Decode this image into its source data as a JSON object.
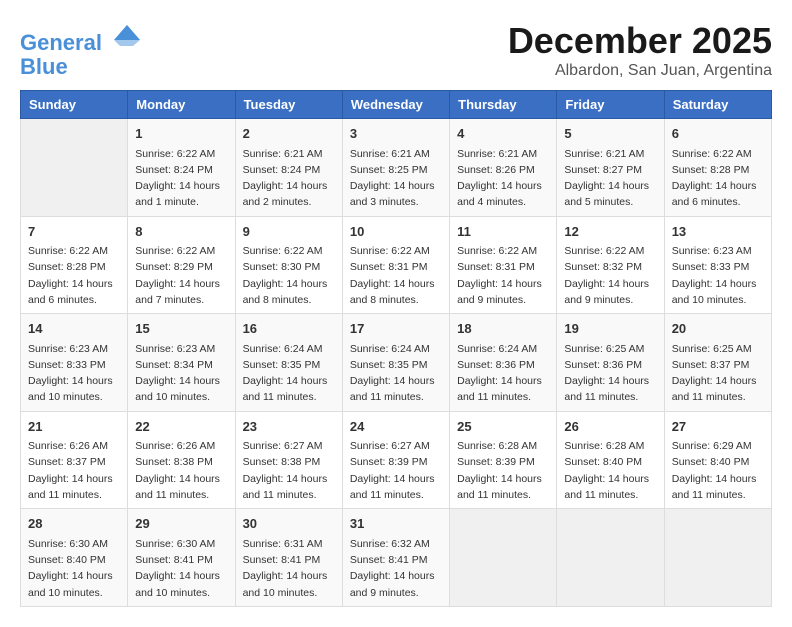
{
  "header": {
    "logo_line1": "General",
    "logo_line2": "Blue",
    "month": "December 2025",
    "location": "Albardon, San Juan, Argentina"
  },
  "days_of_week": [
    "Sunday",
    "Monday",
    "Tuesday",
    "Wednesday",
    "Thursday",
    "Friday",
    "Saturday"
  ],
  "weeks": [
    [
      {
        "day": "",
        "content": ""
      },
      {
        "day": "1",
        "content": "Sunrise: 6:22 AM\nSunset: 8:24 PM\nDaylight: 14 hours\nand 1 minute."
      },
      {
        "day": "2",
        "content": "Sunrise: 6:21 AM\nSunset: 8:24 PM\nDaylight: 14 hours\nand 2 minutes."
      },
      {
        "day": "3",
        "content": "Sunrise: 6:21 AM\nSunset: 8:25 PM\nDaylight: 14 hours\nand 3 minutes."
      },
      {
        "day": "4",
        "content": "Sunrise: 6:21 AM\nSunset: 8:26 PM\nDaylight: 14 hours\nand 4 minutes."
      },
      {
        "day": "5",
        "content": "Sunrise: 6:21 AM\nSunset: 8:27 PM\nDaylight: 14 hours\nand 5 minutes."
      },
      {
        "day": "6",
        "content": "Sunrise: 6:22 AM\nSunset: 8:28 PM\nDaylight: 14 hours\nand 6 minutes."
      }
    ],
    [
      {
        "day": "7",
        "content": "Sunrise: 6:22 AM\nSunset: 8:28 PM\nDaylight: 14 hours\nand 6 minutes."
      },
      {
        "day": "8",
        "content": "Sunrise: 6:22 AM\nSunset: 8:29 PM\nDaylight: 14 hours\nand 7 minutes."
      },
      {
        "day": "9",
        "content": "Sunrise: 6:22 AM\nSunset: 8:30 PM\nDaylight: 14 hours\nand 8 minutes."
      },
      {
        "day": "10",
        "content": "Sunrise: 6:22 AM\nSunset: 8:31 PM\nDaylight: 14 hours\nand 8 minutes."
      },
      {
        "day": "11",
        "content": "Sunrise: 6:22 AM\nSunset: 8:31 PM\nDaylight: 14 hours\nand 9 minutes."
      },
      {
        "day": "12",
        "content": "Sunrise: 6:22 AM\nSunset: 8:32 PM\nDaylight: 14 hours\nand 9 minutes."
      },
      {
        "day": "13",
        "content": "Sunrise: 6:23 AM\nSunset: 8:33 PM\nDaylight: 14 hours\nand 10 minutes."
      }
    ],
    [
      {
        "day": "14",
        "content": "Sunrise: 6:23 AM\nSunset: 8:33 PM\nDaylight: 14 hours\nand 10 minutes."
      },
      {
        "day": "15",
        "content": "Sunrise: 6:23 AM\nSunset: 8:34 PM\nDaylight: 14 hours\nand 10 minutes."
      },
      {
        "day": "16",
        "content": "Sunrise: 6:24 AM\nSunset: 8:35 PM\nDaylight: 14 hours\nand 11 minutes."
      },
      {
        "day": "17",
        "content": "Sunrise: 6:24 AM\nSunset: 8:35 PM\nDaylight: 14 hours\nand 11 minutes."
      },
      {
        "day": "18",
        "content": "Sunrise: 6:24 AM\nSunset: 8:36 PM\nDaylight: 14 hours\nand 11 minutes."
      },
      {
        "day": "19",
        "content": "Sunrise: 6:25 AM\nSunset: 8:36 PM\nDaylight: 14 hours\nand 11 minutes."
      },
      {
        "day": "20",
        "content": "Sunrise: 6:25 AM\nSunset: 8:37 PM\nDaylight: 14 hours\nand 11 minutes."
      }
    ],
    [
      {
        "day": "21",
        "content": "Sunrise: 6:26 AM\nSunset: 8:37 PM\nDaylight: 14 hours\nand 11 minutes."
      },
      {
        "day": "22",
        "content": "Sunrise: 6:26 AM\nSunset: 8:38 PM\nDaylight: 14 hours\nand 11 minutes."
      },
      {
        "day": "23",
        "content": "Sunrise: 6:27 AM\nSunset: 8:38 PM\nDaylight: 14 hours\nand 11 minutes."
      },
      {
        "day": "24",
        "content": "Sunrise: 6:27 AM\nSunset: 8:39 PM\nDaylight: 14 hours\nand 11 minutes."
      },
      {
        "day": "25",
        "content": "Sunrise: 6:28 AM\nSunset: 8:39 PM\nDaylight: 14 hours\nand 11 minutes."
      },
      {
        "day": "26",
        "content": "Sunrise: 6:28 AM\nSunset: 8:40 PM\nDaylight: 14 hours\nand 11 minutes."
      },
      {
        "day": "27",
        "content": "Sunrise: 6:29 AM\nSunset: 8:40 PM\nDaylight: 14 hours\nand 11 minutes."
      }
    ],
    [
      {
        "day": "28",
        "content": "Sunrise: 6:30 AM\nSunset: 8:40 PM\nDaylight: 14 hours\nand 10 minutes."
      },
      {
        "day": "29",
        "content": "Sunrise: 6:30 AM\nSunset: 8:41 PM\nDaylight: 14 hours\nand 10 minutes."
      },
      {
        "day": "30",
        "content": "Sunrise: 6:31 AM\nSunset: 8:41 PM\nDaylight: 14 hours\nand 10 minutes."
      },
      {
        "day": "31",
        "content": "Sunrise: 6:32 AM\nSunset: 8:41 PM\nDaylight: 14 hours\nand 9 minutes."
      },
      {
        "day": "",
        "content": ""
      },
      {
        "day": "",
        "content": ""
      },
      {
        "day": "",
        "content": ""
      }
    ]
  ]
}
